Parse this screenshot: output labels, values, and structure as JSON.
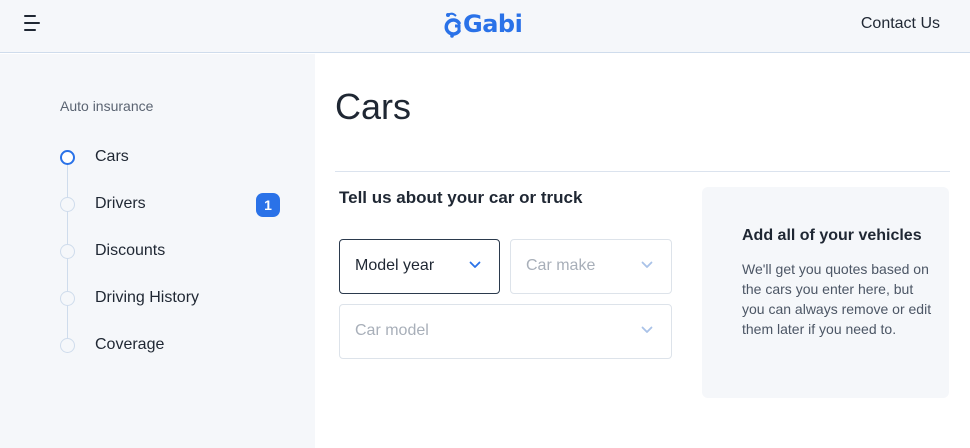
{
  "header": {
    "brand": "Gabi",
    "contact_label": "Contact Us"
  },
  "sidebar": {
    "title": "Auto insurance",
    "steps": [
      {
        "label": "Cars",
        "active": true
      },
      {
        "label": "Drivers",
        "badge": "1"
      },
      {
        "label": "Discounts"
      },
      {
        "label": "Driving History"
      },
      {
        "label": "Coverage"
      }
    ]
  },
  "main": {
    "title": "Cars",
    "section_title": "Tell us about your car or truck",
    "fields": {
      "model_year": "Model year",
      "car_make": "Car make",
      "car_model": "Car model"
    }
  },
  "info_card": {
    "title": "Add all of your vehicles",
    "body": "We'll get you quotes based on the cars you enter here, but you can always remove or edit them later if you need to."
  },
  "colors": {
    "brand": "#2a72e8",
    "sidebar_bg": "#f5f7fa",
    "text": "#1f2733",
    "placeholder": "#a8afb9"
  },
  "icons": [
    "menu-icon",
    "gabi-logo-icon",
    "chevron-down-icon"
  ]
}
